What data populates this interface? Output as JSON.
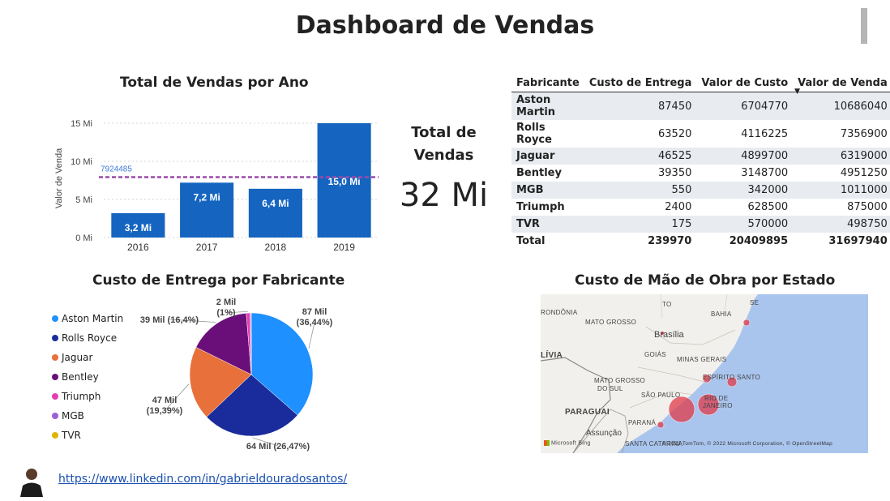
{
  "page": {
    "title": "Dashboard de Vendas",
    "link": "https://www.linkedin.com/in/gabrieldouradosantos/"
  },
  "colors": {
    "bar": "#1565c0",
    "avg_line": "#9c4aa8",
    "pie": [
      "#1e90ff",
      "#1a2c9c",
      "#e8703a",
      "#6a0f7a",
      "#e63eb0",
      "#9b5fd6",
      "#e0b400"
    ],
    "map_water": "#a9c5ee",
    "bubble": "#e03a4a"
  },
  "chart_data": [
    {
      "type": "bar",
      "title": "Total de Vendas por Ano",
      "categories": [
        "2016",
        "2017",
        "2018",
        "2019"
      ],
      "values": [
        3.2,
        7.2,
        6.4,
        15.0
      ],
      "value_labels": [
        "3,2 Mi",
        "7,2 Mi",
        "6,4 Mi",
        "15,0 Mi"
      ],
      "ylabel": "Valor de Venda",
      "yticks": [
        "0 Mi",
        "5 Mi",
        "10 Mi",
        "15 Mi"
      ],
      "ylim": [
        0,
        15
      ],
      "average": 7.924485,
      "average_label": "7924485",
      "grid": true
    },
    {
      "type": "pie",
      "title": "Custo de Entrega por Fabricante",
      "labels": [
        "Aston Martin",
        "Rolls Royce",
        "Jaguar",
        "Bentley",
        "Triumph",
        "MGB",
        "TVR"
      ],
      "values": [
        87450,
        63520,
        46525,
        39350,
        2400,
        550,
        175
      ],
      "legend_position": "left",
      "data_labels": [
        {
          "line1": "87 Mil",
          "line2": "(36,44%)"
        },
        {
          "line1": "64 Mil (26,47%)",
          "line2": ""
        },
        {
          "line1": "47 Mil",
          "line2": "(19,39%)"
        },
        {
          "line1": "39 Mil (16,4%)",
          "line2": ""
        },
        {
          "line1": "2 Mil",
          "line2": "(1%)"
        }
      ]
    }
  ],
  "kpi": {
    "label": "Total de Vendas",
    "value": "32 Mi"
  },
  "table": {
    "headers": [
      "Fabricante",
      "Custo de Entrega",
      "Valor de Custo",
      "Valor de Venda"
    ],
    "sort_indicator": "▼",
    "rows": [
      [
        "Aston Martin",
        "87450",
        "6704770",
        "10686040"
      ],
      [
        "Rolls Royce",
        "63520",
        "4116225",
        "7356900"
      ],
      [
        "Jaguar",
        "46525",
        "4899700",
        "6319000"
      ],
      [
        "Bentley",
        "39350",
        "3148700",
        "4951250"
      ],
      [
        "MGB",
        "550",
        "342000",
        "1011000"
      ],
      [
        "Triumph",
        "2400",
        "628500",
        "875000"
      ],
      [
        "TVR",
        "175",
        "570000",
        "498750"
      ]
    ],
    "total": [
      "Total",
      "239970",
      "20409895",
      "31697940"
    ]
  },
  "map": {
    "title": "Custo de Mão de Obra por Estado",
    "labels": {
      "rondonia": "RONDÔNIA",
      "to": "TO",
      "bahia": "BAHIA",
      "se": "SE",
      "mato_grosso": "MATO GROSSO",
      "brasilia": "Brasília",
      "bolivia": "LÍVIA",
      "goias": "GOIÁS",
      "minas": "MINAS GERAIS",
      "ms1": "MATO GROSSO",
      "ms2": "DO SUL",
      "espirito": "ESPÍRITO SANTO",
      "sao_paulo": "SÃO PAULO",
      "rio1": "RIO DE",
      "rio2": "JANEIRO",
      "paraguai": "PARAGUAI",
      "parana": "PARANÁ",
      "assuncao": "Assunção",
      "santa_catarina": "SANTA CATARINA"
    },
    "bing": "Microsoft Bing",
    "attribution": "© 2022 TomTom, © 2022 Microsoft Corporation, © OpenStreetMap"
  }
}
